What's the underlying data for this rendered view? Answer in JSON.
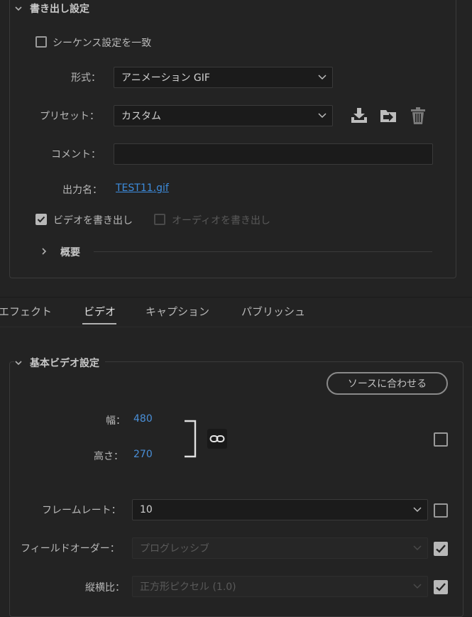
{
  "export_settings": {
    "section_title": "書き出し設定",
    "match_sequence_label": "シーケンス設定を一致",
    "match_sequence_checked": false,
    "format_label": "形式：",
    "format_value": "アニメーション GIF",
    "preset_label": "プリセット：",
    "preset_value": "カスタム",
    "comment_label": "コメント：",
    "comment_value": "",
    "output_name_label": "出力名：",
    "output_name_value": "TEST11.gif",
    "export_video_label": "ビデオを書き出し",
    "export_video_checked": true,
    "export_audio_label": "オーディオを書き出し",
    "export_audio_checked": false,
    "summary_label": "概要"
  },
  "tabs": [
    {
      "label": "エフェクト",
      "active": false
    },
    {
      "label": "ビデオ",
      "active": true
    },
    {
      "label": "キャプション",
      "active": false
    },
    {
      "label": "パブリッシュ",
      "active": false
    }
  ],
  "basic_video": {
    "section_title": "基本ビデオ設定",
    "match_source_label": "ソースに合わせる",
    "width_label": "幅：",
    "width_value": "480",
    "height_label": "高さ：",
    "height_value": "270",
    "size_override_checked": false,
    "frame_rate_label": "フレームレート：",
    "frame_rate_value": "10",
    "frame_rate_override_checked": false,
    "field_order_label": "フィールドオーダー：",
    "field_order_value": "プログレッシブ",
    "field_order_override_checked": true,
    "aspect_label": "縦横比：",
    "aspect_value": "正方形ピクセル (1.0)",
    "aspect_override_checked": true
  },
  "icons": {
    "save_preset": "download-icon",
    "import_preset": "folder-import-icon",
    "delete_preset": "trash-icon",
    "link": "chain-link-icon"
  },
  "colors": {
    "background": "#232323",
    "link": "#3d8cdd",
    "number": "#4a8fd8"
  }
}
